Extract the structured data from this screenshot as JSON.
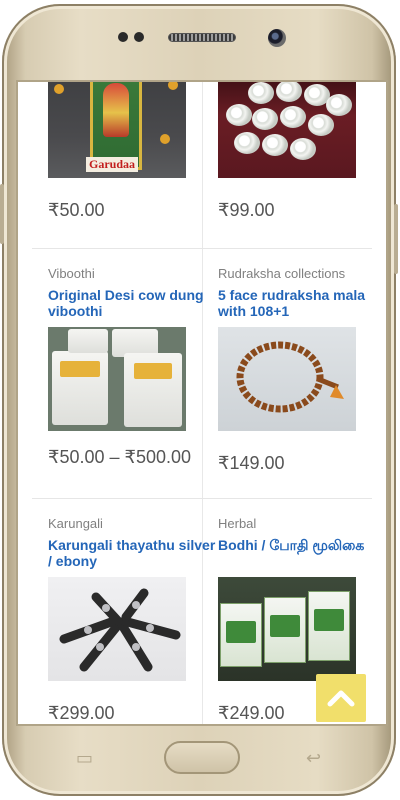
{
  "products": [
    {
      "category": "",
      "title": "",
      "price": "₹50.00",
      "image_label": "Garudaa",
      "image": "garuda-frame"
    },
    {
      "category": "",
      "title": "",
      "price": "₹99.00",
      "image": "white-stones"
    },
    {
      "category": "Viboothi",
      "title": "Original Desi cow dung viboothi",
      "price": "₹50.00 – ₹500.00",
      "image": "viboothi-packets"
    },
    {
      "category": "Rudraksha collections",
      "title": "5 face rudraksha mala with 108+1",
      "price": "₹149.00",
      "image": "rudraksha-mala"
    },
    {
      "category": "Karungali",
      "title": "Karungali thayathu silver / ebony",
      "price": "₹299.00",
      "image": "karungali-thayathu"
    },
    {
      "category": "Herbal",
      "title": "Bodhi / போதி மூலிகை",
      "price": "₹249.00",
      "image": "herbal-boxes"
    }
  ],
  "scroll_top": {
    "icon": "chevron-up-icon"
  },
  "colors": {
    "link": "#2466b8",
    "price": "#555555",
    "category": "#808080",
    "scroll_top_bg": "#f1df6b"
  }
}
